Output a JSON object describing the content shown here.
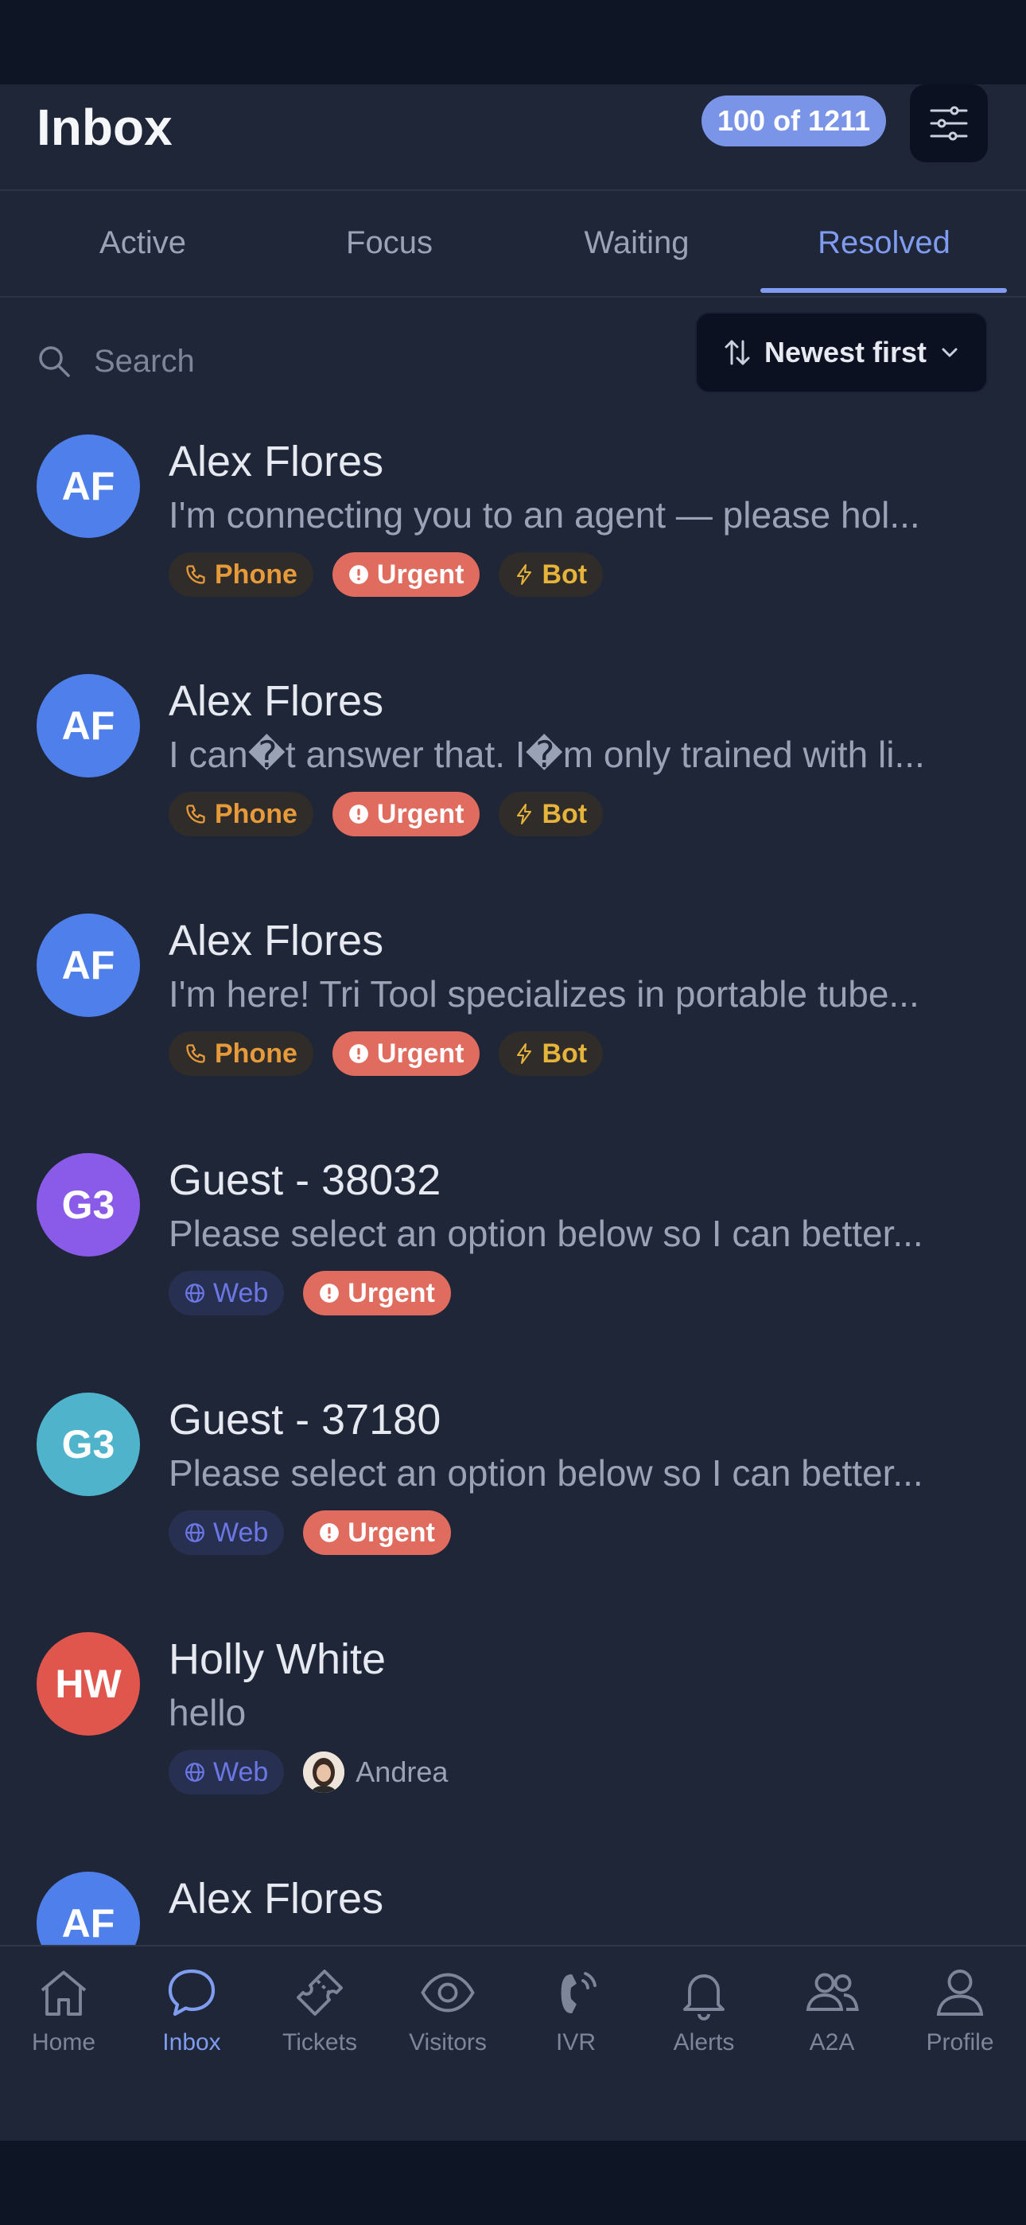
{
  "header": {
    "title": "Inbox",
    "count": "100 of 1211"
  },
  "tabs": [
    {
      "label": "Active"
    },
    {
      "label": "Focus"
    },
    {
      "label": "Waiting"
    },
    {
      "label": "Resolved"
    }
  ],
  "search": {
    "placeholder": "Search"
  },
  "sort": {
    "label": "Newest first"
  },
  "conversations": [
    {
      "initials": "AF",
      "name": "Alex Flores",
      "preview": "I'm connecting you to an agent — please hol...",
      "tags": [
        "Phone",
        "Urgent",
        "Bot"
      ],
      "avatar_color": "#4f7fea"
    },
    {
      "initials": "AF",
      "name": "Alex Flores",
      "preview": "I can�t answer that. I�m only trained with li...",
      "tags": [
        "Phone",
        "Urgent",
        "Bot"
      ],
      "avatar_color": "#4f7fea"
    },
    {
      "initials": "AF",
      "name": "Alex Flores",
      "preview": "I'm here! Tri Tool specializes in portable tube...",
      "tags": [
        "Phone",
        "Urgent",
        "Bot"
      ],
      "avatar_color": "#4f7fea"
    },
    {
      "initials": "G3",
      "name": "Guest - 38032",
      "preview": "Please select an option below so I can better...",
      "tags": [
        "Web",
        "Urgent"
      ],
      "avatar_color": "#8a5be8"
    },
    {
      "initials": "G3",
      "name": "Guest - 37180",
      "preview": "Please select an option below so I can better...",
      "tags": [
        "Web",
        "Urgent"
      ],
      "avatar_color": "#4fb3cc"
    },
    {
      "initials": "HW",
      "name": "Holly White",
      "preview": "hello",
      "tags": [
        "Web"
      ],
      "agent": "Andrea",
      "avatar_color": "#e0564d"
    },
    {
      "initials": "AF",
      "name": "Alex Flores",
      "preview": "",
      "tags": [],
      "avatar_color": "#4f7fea"
    }
  ],
  "nav": [
    {
      "label": "Home",
      "icon": "home-icon"
    },
    {
      "label": "Inbox",
      "icon": "chat-bubble-icon"
    },
    {
      "label": "Tickets",
      "icon": "ticket-icon"
    },
    {
      "label": "Visitors",
      "icon": "eye-icon"
    },
    {
      "label": "IVR",
      "icon": "phone-icon"
    },
    {
      "label": "Alerts",
      "icon": "bell-icon"
    },
    {
      "label": "A2A",
      "icon": "users-icon"
    },
    {
      "label": "Profile",
      "icon": "user-icon"
    }
  ],
  "colors": {
    "accent": "#7f9cf0",
    "urgent": "#e06b5f",
    "phone": "#e69a3a",
    "bot": "#e6b43a",
    "web": "#6c77e6"
  }
}
